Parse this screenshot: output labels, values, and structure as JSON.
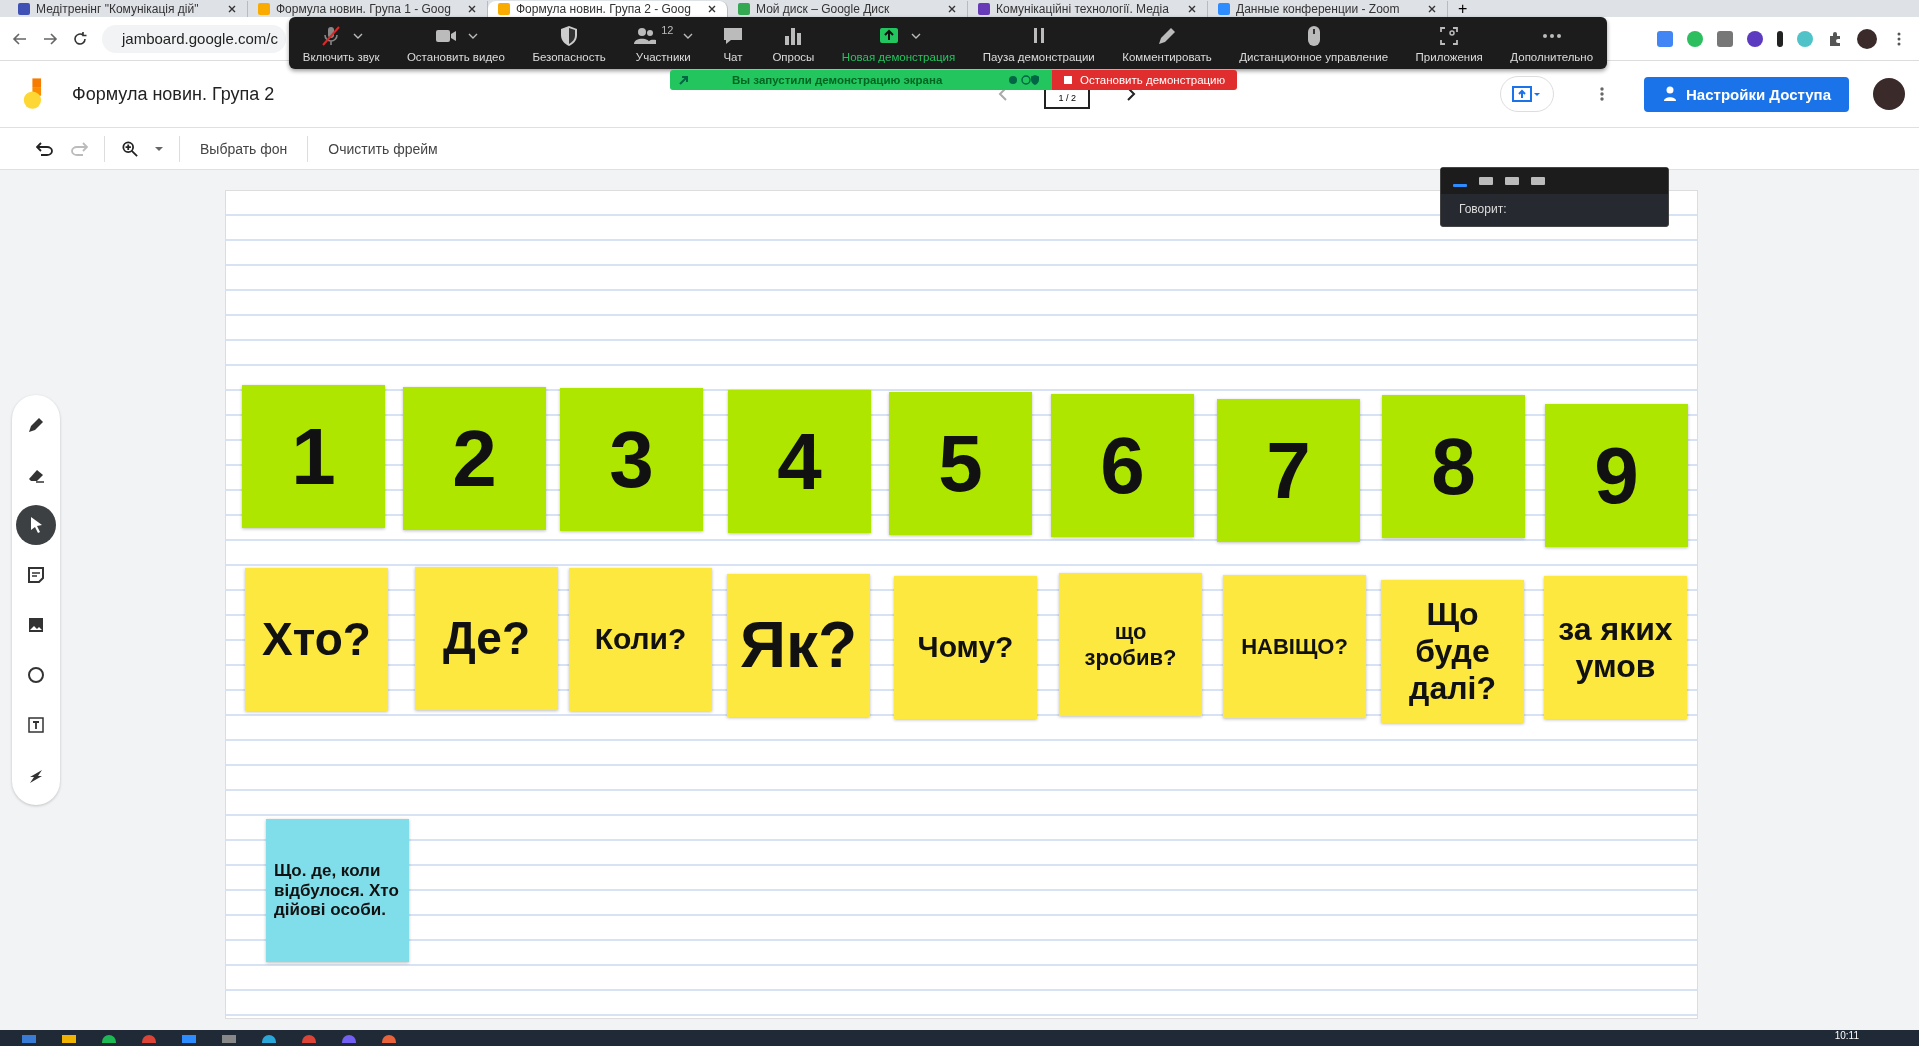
{
  "browser_tabs": [
    {
      "title": "Медітренінг \"Комунікація дій\"",
      "kind": "doc",
      "selected": false
    },
    {
      "title": "Формула новин. Група 1 - Goog",
      "kind": "jam",
      "selected": false
    },
    {
      "title": "Формула новин. Група 2 - Goog",
      "kind": "jam",
      "selected": true
    },
    {
      "title": "Мой диск – Google Диск",
      "kind": "drive",
      "selected": false
    },
    {
      "title": "Комунікаційні технології. Медіа",
      "kind": "form",
      "selected": false
    },
    {
      "title": "Данные конференции - Zoom",
      "kind": "zoom",
      "selected": false
    }
  ],
  "new_tab": "+",
  "address": "jamboard.google.com/c",
  "zoom_toolbar": [
    {
      "label": "Включить звук",
      "kind": "mic",
      "menu": true,
      "highlighted": false
    },
    {
      "label": "Остановить видео",
      "kind": "video",
      "menu": true,
      "highlighted": false
    },
    {
      "label": "Безопасность",
      "kind": "shield",
      "menu": false,
      "highlighted": false
    },
    {
      "label": "Участники",
      "kind": "people",
      "menu": true,
      "highlighted": false,
      "count": "12"
    },
    {
      "label": "Чат",
      "kind": "chat",
      "menu": false,
      "highlighted": false
    },
    {
      "label": "Опросы",
      "kind": "poll",
      "menu": false,
      "highlighted": false
    },
    {
      "label": "Новая демонстрация",
      "kind": "share",
      "menu": true,
      "highlighted": true
    },
    {
      "label": "Пауза демонстрации",
      "kind": "pause",
      "menu": false,
      "highlighted": false
    },
    {
      "label": "Комментировать",
      "kind": "pen",
      "menu": false,
      "highlighted": false
    },
    {
      "label": "Дистанционное управление",
      "kind": "mouse",
      "menu": false,
      "highlighted": false
    },
    {
      "label": "Приложения",
      "kind": "apps",
      "menu": false,
      "highlighted": false
    },
    {
      "label": "Дополнительно",
      "kind": "more",
      "menu": false,
      "highlighted": false
    }
  ],
  "share_banner": {
    "text": "Вы запустили демонстрацию экрана",
    "stop": "Остановить демонстрацию"
  },
  "header": {
    "title": "Формула новин. Група 2",
    "page": "1 / 2",
    "share_button": "Настройки Доступа"
  },
  "toolbar": {
    "buttons": [
      "Выбрать фон",
      "Очистить фрейм"
    ]
  },
  "tools": [
    {
      "kind": "pen",
      "selected": false
    },
    {
      "kind": "eraser",
      "selected": false
    },
    {
      "kind": "select",
      "selected": true
    },
    {
      "kind": "note",
      "selected": false
    },
    {
      "kind": "image",
      "selected": false
    },
    {
      "kind": "circle",
      "selected": false
    },
    {
      "kind": "textbox",
      "selected": false
    },
    {
      "kind": "laser",
      "selected": false
    }
  ],
  "speaker_panel": {
    "views": [
      {
        "selected": true
      },
      {
        "selected": false
      },
      {
        "selected": false
      },
      {
        "selected": false
      }
    ],
    "label": "Говорит:"
  },
  "notes": [
    {
      "text": "1",
      "color": "#aee600"
    },
    {
      "text": "2",
      "color": "#aee600"
    },
    {
      "text": "3",
      "color": "#aee600"
    },
    {
      "text": "4",
      "color": "#aee600"
    },
    {
      "text": "5",
      "color": "#aee600"
    },
    {
      "text": "6",
      "color": "#aee600"
    },
    {
      "text": "7",
      "color": "#aee600"
    },
    {
      "text": "8",
      "color": "#aee600"
    },
    {
      "text": "9",
      "color": "#aee600"
    },
    {
      "text": "Хто?",
      "color": "#fde83f"
    },
    {
      "text": "Де?",
      "color": "#fde83f"
    },
    {
      "text": "Коли?",
      "color": "#fde83f"
    },
    {
      "text": "Як?",
      "color": "#fde83f"
    },
    {
      "text": "Чому?",
      "color": "#fde83f"
    },
    {
      "text": "що зробив?",
      "color": "#fde83f"
    },
    {
      "text": "НАВІЩО?",
      "color": "#fde83f"
    },
    {
      "text": "Що буде далі?",
      "color": "#fde83f"
    },
    {
      "text": "за яких умов",
      "color": "#fde83f"
    },
    {
      "text": "Що. де, коли відбулося. Хто дійові особи.",
      "color": "#80deea"
    }
  ],
  "taskbar": {
    "clock": "10:11"
  }
}
